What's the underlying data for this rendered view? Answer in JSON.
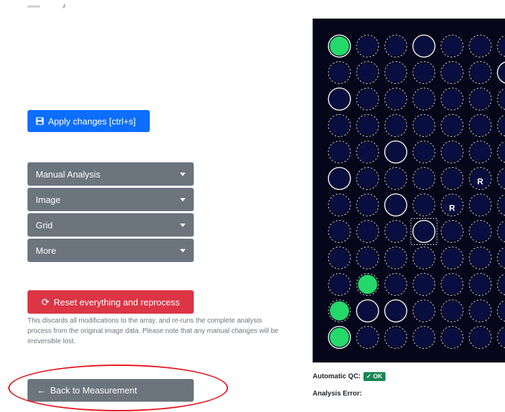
{
  "toolbar": {
    "apply_label": "Apply changes [ctrl+s]",
    "apply_icon": "save-icon"
  },
  "accordions": [
    {
      "label": "Manual Analysis"
    },
    {
      "label": "Image"
    },
    {
      "label": "Grid"
    },
    {
      "label": "More"
    }
  ],
  "reset": {
    "label": "Reset everything and reprocess",
    "icon": "refresh-icon",
    "help": "This discards all modifications to the array, and re-runs the complete analysis process from the original image data. Please note that any manual changes will be irreversible lost."
  },
  "back": {
    "label": "Back to Measurement",
    "icon": "arrow-left-icon"
  },
  "qc": {
    "label": "Automatic QC:",
    "badge": "✓ OK"
  },
  "analysis_error": {
    "label": "Analysis Error:"
  },
  "array": {
    "spot_labels": [
      "R",
      "R"
    ],
    "colors": {
      "background": "#06061a",
      "spot_fill": "#0b1860",
      "green_spot": "#25d86a",
      "dashed_ring": "#cfd3e8",
      "solid_ring": "#e8e8f0"
    },
    "columns_visible": 7,
    "rows_visible": 12
  }
}
